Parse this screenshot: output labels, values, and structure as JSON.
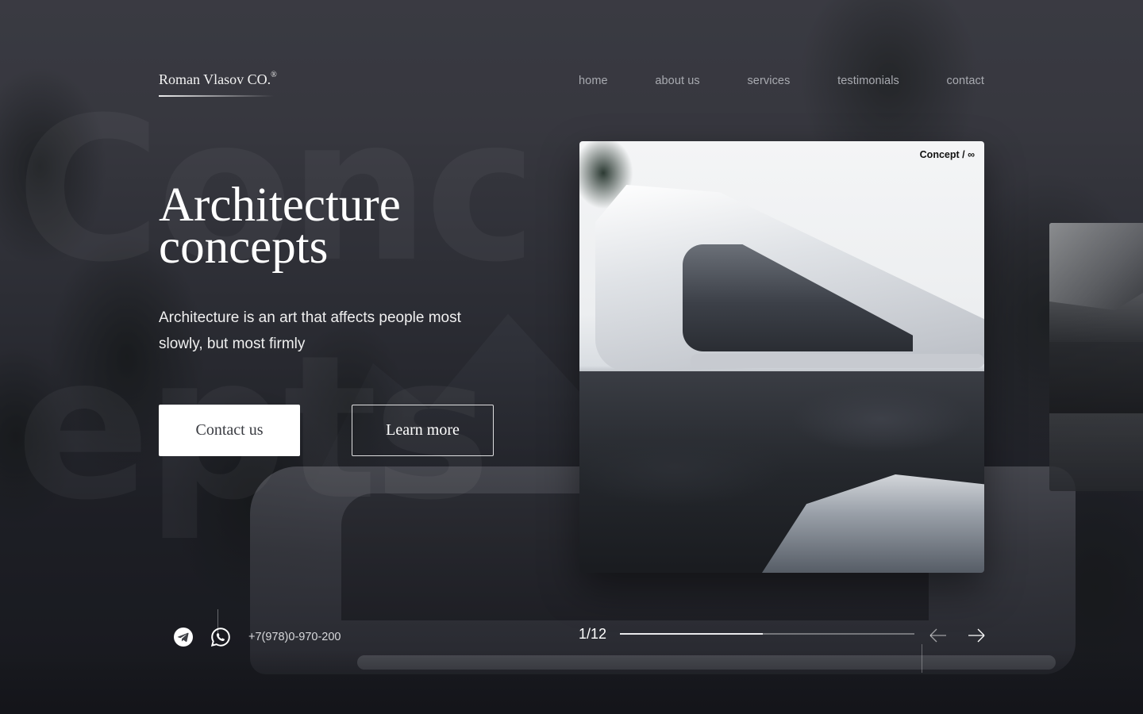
{
  "brand": {
    "name": "Roman Vlasov CO.",
    "mark": "®"
  },
  "nav": {
    "items": [
      "home",
      "about us",
      "services",
      "testimonials",
      "contact"
    ]
  },
  "hero": {
    "title_line1": "Architecture",
    "title_line2": "concepts",
    "description": "Architecture is an art that affects people most slowly, but most firmly",
    "contact_button": "Contact us",
    "learn_button": "Learn more"
  },
  "card": {
    "label": "Concept / ∞"
  },
  "contact": {
    "phone": "+7(978)0-970-200",
    "icons": [
      "telegram-icon",
      "whatsapp-icon"
    ]
  },
  "slider": {
    "counter": "1/12",
    "current": 1,
    "total": 12,
    "progress": 0.485
  },
  "colors": {
    "background": "#3d3f45",
    "text": "#ffffff",
    "nav_text": "#a9abb1",
    "button_fill": "#ffffff"
  }
}
